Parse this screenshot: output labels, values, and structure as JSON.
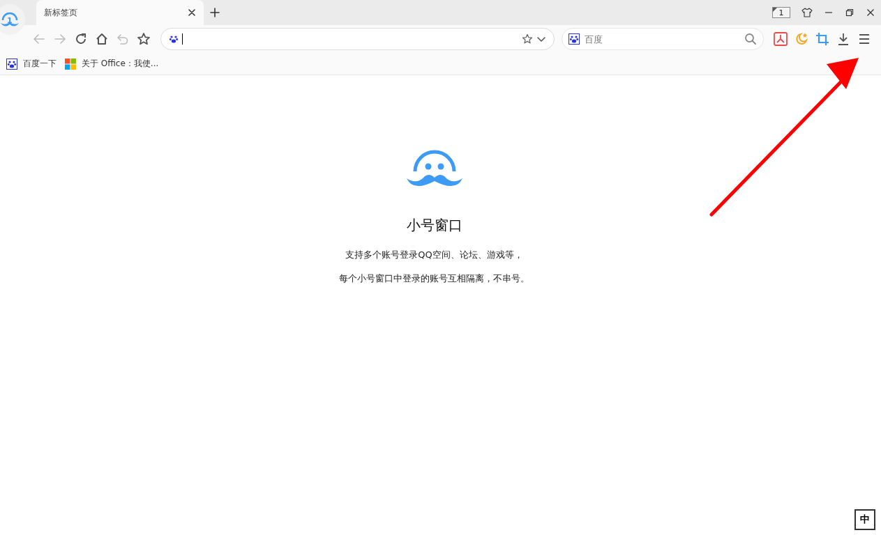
{
  "tab": {
    "title": "新标签页",
    "selected": true
  },
  "window_controls": {
    "window_count": "1"
  },
  "search_box": {
    "placeholder": "百度"
  },
  "bookmarks": [
    {
      "label": "百度一下",
      "kind": "baidu"
    },
    {
      "label": "关于 Office：我使...",
      "kind": "office"
    }
  ],
  "content": {
    "title": "小号窗口",
    "lines": [
      "支持多个账号登录QQ空间、论坛、游戏等，",
      "每个小号窗口中登录的账号互相隔离，不串号。"
    ]
  },
  "ime_indicator": "中",
  "profile_number": "1"
}
